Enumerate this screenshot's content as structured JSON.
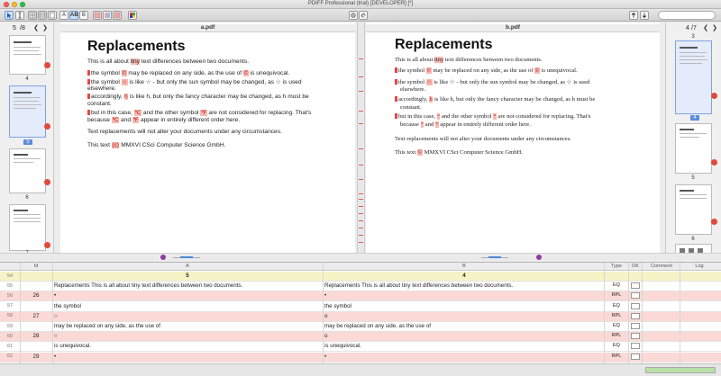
{
  "window": {
    "title": "PDIFF Professional (trial) [DEVELOPER] [*]"
  },
  "toolbar": {
    "buttons": [
      "pointer-tool",
      "text-select",
      "grid-view",
      "table-view",
      "single-view"
    ],
    "text_buttons": [
      "A",
      "AB",
      "B"
    ],
    "settings_icon": "gear-icon",
    "link_icon": "link-icon",
    "up_icon": "arrow-up-icon",
    "down_icon": "arrow-down-icon"
  },
  "left_thumbs": {
    "page_current": "5",
    "page_total": "/8",
    "pages": [
      "4",
      "5",
      "6",
      "7"
    ]
  },
  "right_thumbs": {
    "page_current": "4",
    "page_total": "/7",
    "pages": [
      "3",
      "4",
      "5",
      "6"
    ]
  },
  "pane_a": {
    "file": "a.pdf",
    "heading": "Replacements",
    "intro_pre": "This is all about ",
    "intro_hl": "tiny",
    "intro_post": " text differences between two documents.",
    "l1_a": "the symbol ",
    "l1_hl1": "©",
    "l1_b": " may be replaced on any side, as the use of ",
    "l1_hl2": "©",
    "l1_c": " is unequivocal.",
    "l2_a": "the symbol ",
    "l2_hl": "☆",
    "l2_b": " is like ☆ - but only the sun symbol may be changed, as ☆ is used",
    "l2_c": "elsewhere.",
    "l3_a": "accordingly, ",
    "l3_hl": "h",
    "l3_b": " is like h, but only the fancy character may be changed, as h must be",
    "l3_c": "constant.",
    "l4_a": "but in this case, ",
    "l4_hl1": "℃",
    "l4_b": " and the other symbol ",
    "l4_hl2": "℉",
    "l4_c": " are not considered for replacing. That's",
    "l4_d": "because ",
    "l4_hl3": "℃",
    "l4_e": " and ",
    "l4_hl4": "℉",
    "l4_f": " appear in entirely different order here.",
    "p2": "Text replacements will not alter your documents under any circumstances.",
    "p3_a": "This text ",
    "p3_hl": "(c)",
    "p3_b": " MMXVI CSci Computer Science GmbH."
  },
  "pane_b": {
    "file": "b.pdf",
    "heading": "Replacements",
    "intro_pre": "This is all about ",
    "intro_hl": "tiny",
    "intro_post": " text differences between two documents.",
    "l1_a": "the symbol ",
    "l1_hl1": "©",
    "l1_b": " may be replaced on any side, as the use of ",
    "l1_hl2": "©",
    "l1_c": " is unequivocal.",
    "l2_a": "the symbol ",
    "l2_hl": "☆",
    "l2_b": " is like ☆ - but only the sun symbol may be changed, as ☆ is used",
    "l2_c": "elsewhere.",
    "l3_a": "accordingly, ",
    "l3_hl": "h",
    "l3_b": " is like h, but only the fancy character may be changed, as h must be",
    "l3_c": "constant.",
    "l4_a": "but in this case, ",
    "l4_hl1": "°",
    "l4_b": " and the other symbol ",
    "l4_hl2": "°",
    "l4_c": " are not considered for replacing. That's",
    "l4_d": "because ",
    "l4_hl3": "°",
    "l4_e": " and ",
    "l4_hl4": "°",
    "l4_f": " appear in entirely different order here.",
    "p2": "Text replacements will not alter your documents under any circumstances.",
    "p3_a": "This text ",
    "p3_hl": "©",
    "p3_b": " MMXVI CSci Computer Science GmbH."
  },
  "table": {
    "columns": [
      "Id",
      "A",
      "B",
      "Type",
      "OK",
      "Comment",
      "Log"
    ],
    "rows": [
      {
        "n": "54",
        "id": "",
        "a": "5",
        "b": "4",
        "type": "",
        "style": "hdr"
      },
      {
        "n": "55",
        "id": "",
        "a": "Replacements This is all about tiny text differences between two documents.",
        "b": "Replacements This is all about tiny text differences between two documents.",
        "type": "EQ",
        "style": ""
      },
      {
        "n": "56",
        "id": "26",
        "a": "•",
        "b": "•",
        "type": "RPL",
        "style": "alt"
      },
      {
        "n": "57",
        "id": "",
        "a": "the symbol",
        "b": "the symbol",
        "type": "EQ",
        "style": ""
      },
      {
        "n": "58",
        "id": "27",
        "a": "○",
        "b": "o",
        "type": "RPL",
        "style": "alt"
      },
      {
        "n": "59",
        "id": "",
        "a": "may be replaced on any side, as the use of",
        "b": "may be replaced on any side, as the use of",
        "type": "EQ",
        "style": ""
      },
      {
        "n": "60",
        "id": "28",
        "a": "○",
        "b": "o",
        "type": "RPL",
        "style": "alt"
      },
      {
        "n": "61",
        "id": "",
        "a": "is unequivocal.",
        "b": "is unequivocal.",
        "type": "EQ",
        "style": ""
      },
      {
        "n": "62",
        "id": "29",
        "a": "•",
        "b": "•",
        "type": "RPL",
        "style": "alt"
      }
    ]
  },
  "status": {
    "progress": 1.0
  },
  "colors": {
    "highlight": "#f7b8b1",
    "diff_row": "#fbd9d6",
    "header_row": "#f6f3c6",
    "accent": "#5d8be0"
  }
}
